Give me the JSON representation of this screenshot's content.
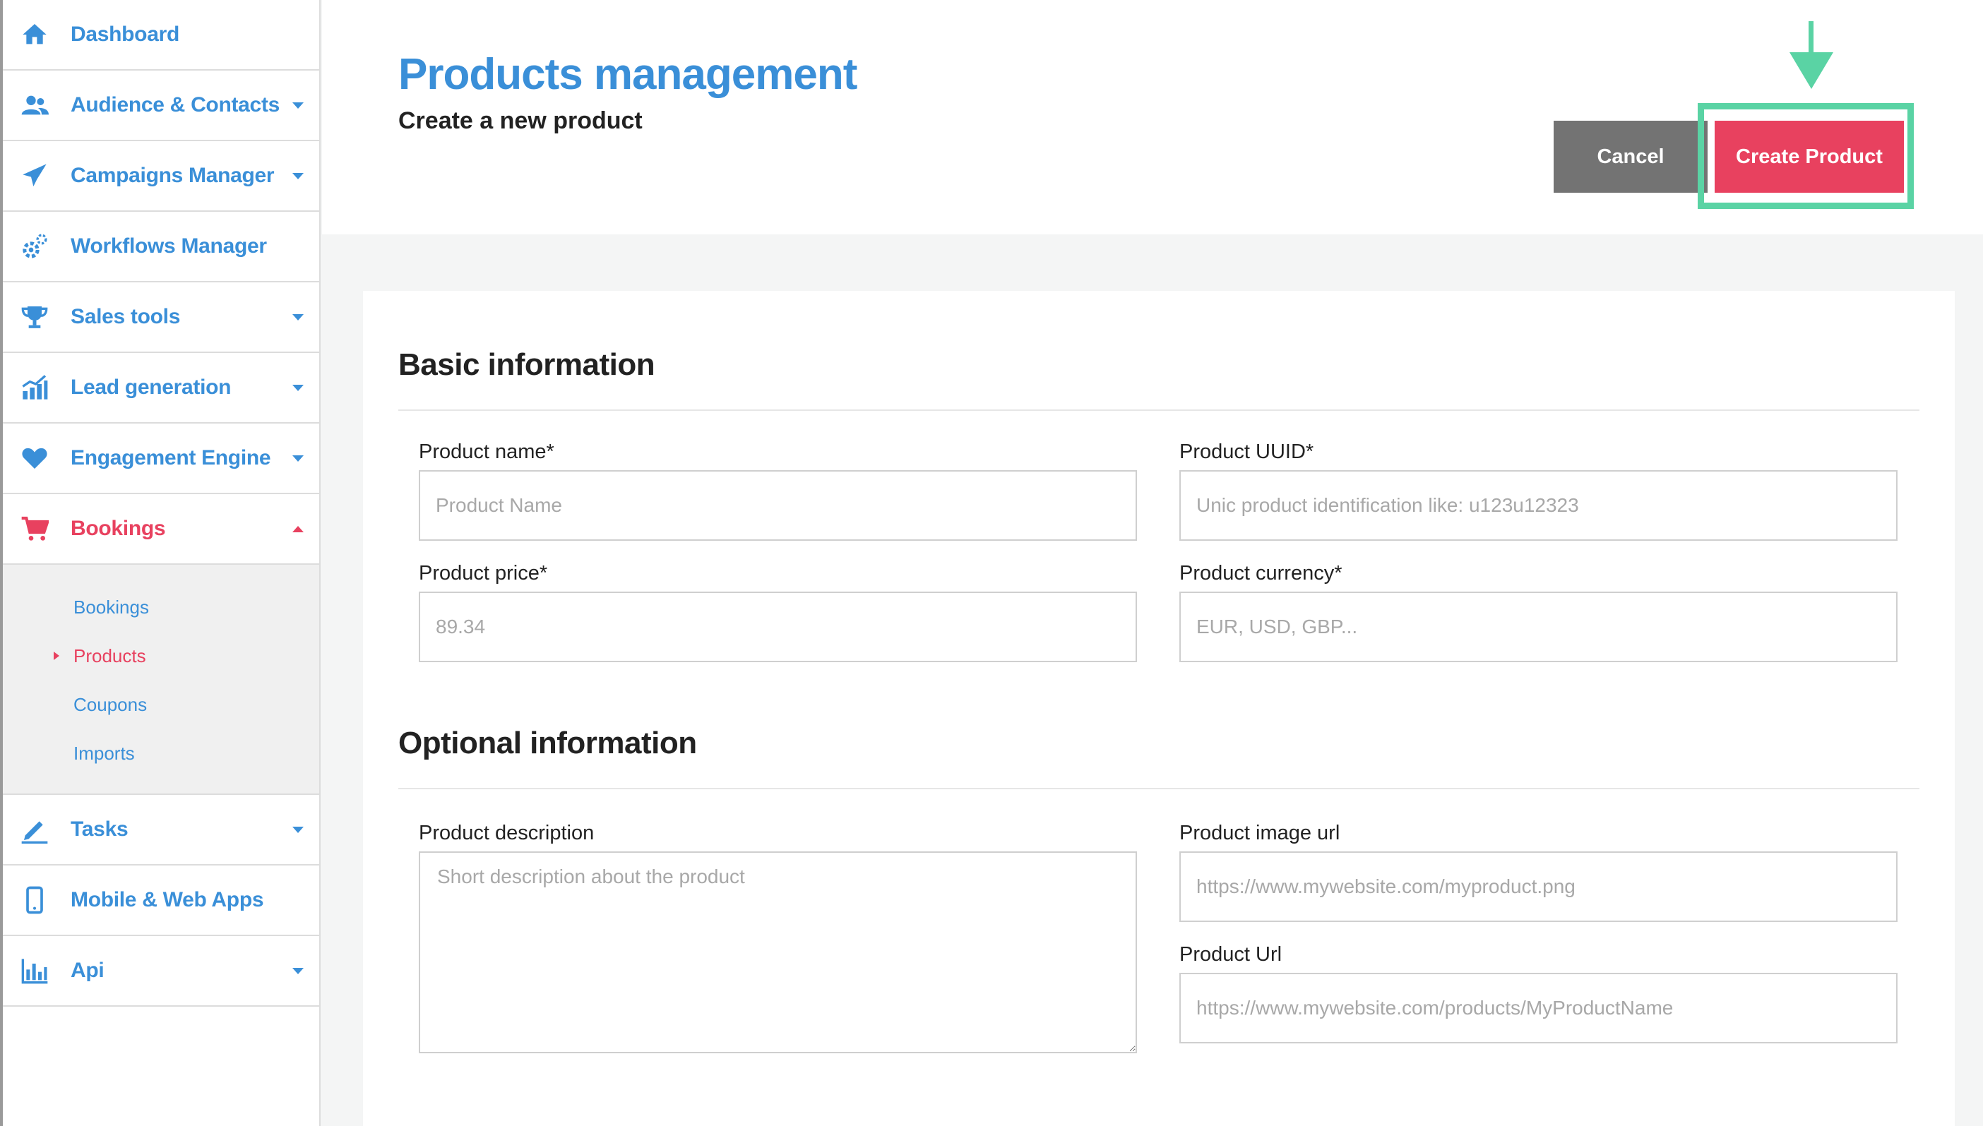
{
  "sidebar": {
    "items": [
      {
        "label": "Dashboard",
        "icon": "home-icon"
      },
      {
        "label": "Audience & Contacts",
        "icon": "users-icon"
      },
      {
        "label": "Campaigns Manager",
        "icon": "paper-plane-icon"
      },
      {
        "label": "Workflows Manager",
        "icon": "gears-icon"
      },
      {
        "label": "Sales tools",
        "icon": "trophy-icon"
      },
      {
        "label": "Lead generation",
        "icon": "growth-chart-icon"
      },
      {
        "label": "Engagement Engine",
        "icon": "heart-icon"
      },
      {
        "label": "Bookings",
        "icon": "shopping-cart-icon"
      },
      {
        "label": "Tasks",
        "icon": "pencil-icon"
      },
      {
        "label": "Mobile & Web Apps",
        "icon": "mobile-phone-icon"
      },
      {
        "label": "Api",
        "icon": "bar-chart-icon"
      }
    ],
    "active_item": "Bookings",
    "bookings_submenu": [
      "Bookings",
      "Products",
      "Coupons",
      "Imports"
    ],
    "active_subitem": "Products"
  },
  "header": {
    "title": "Products management",
    "subtitle": "Create a new product",
    "cancel_label": "Cancel",
    "create_label": "Create Product"
  },
  "form": {
    "basic_title": "Basic information",
    "optional_title": "Optional information",
    "product_name": {
      "label": "Product name*",
      "placeholder": "Product Name",
      "value": ""
    },
    "product_uuid": {
      "label": "Product UUID*",
      "placeholder": "Unic product identification like: u123u12323",
      "value": ""
    },
    "product_price": {
      "label": "Product price*",
      "placeholder": "89.34",
      "value": ""
    },
    "product_currency": {
      "label": "Product currency*",
      "placeholder": "EUR, USD, GBP...",
      "value": ""
    },
    "product_description": {
      "label": "Product description",
      "placeholder": "Short description about the product",
      "value": ""
    },
    "product_image_url": {
      "label": "Product image url",
      "placeholder": "https://www.mywebsite.com/myproduct.png",
      "value": ""
    },
    "product_url": {
      "label": "Product Url",
      "placeholder": "https://www.mywebsite.com/products/MyProductName",
      "value": ""
    }
  },
  "colors": {
    "primary_blue": "#3a8fd8",
    "accent_red": "#e8415f",
    "cancel_gray": "#737373",
    "highlight_green": "#5ad3a4"
  }
}
